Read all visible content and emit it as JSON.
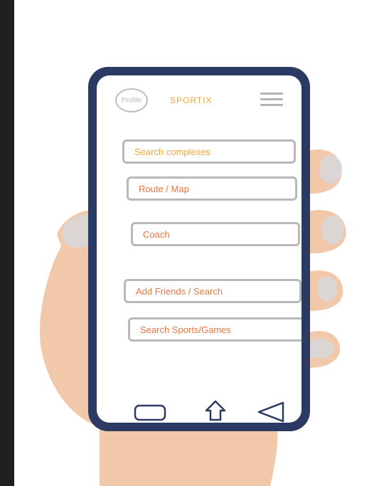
{
  "header": {
    "profile_label": "Profile",
    "brand": "SPORTIX"
  },
  "menu": {
    "buttons": [
      {
        "label": "Search complexes"
      },
      {
        "label": "Route / Map"
      },
      {
        "label": "Coach"
      },
      {
        "label": "Add Friends / Search"
      },
      {
        "label": "Search Sports/Games"
      }
    ]
  },
  "colors": {
    "phone_frame": "#2b3a63",
    "accent_orange": "#f5a63a",
    "accent_red_orange": "#e9773d",
    "skin": "#f2c8aa",
    "nail": "#dbd6d4"
  },
  "icons": {
    "menu": "hamburger-icon",
    "nav_back": "rectangle-icon",
    "nav_home": "home-icon",
    "nav_recent": "triangle-back-icon"
  }
}
